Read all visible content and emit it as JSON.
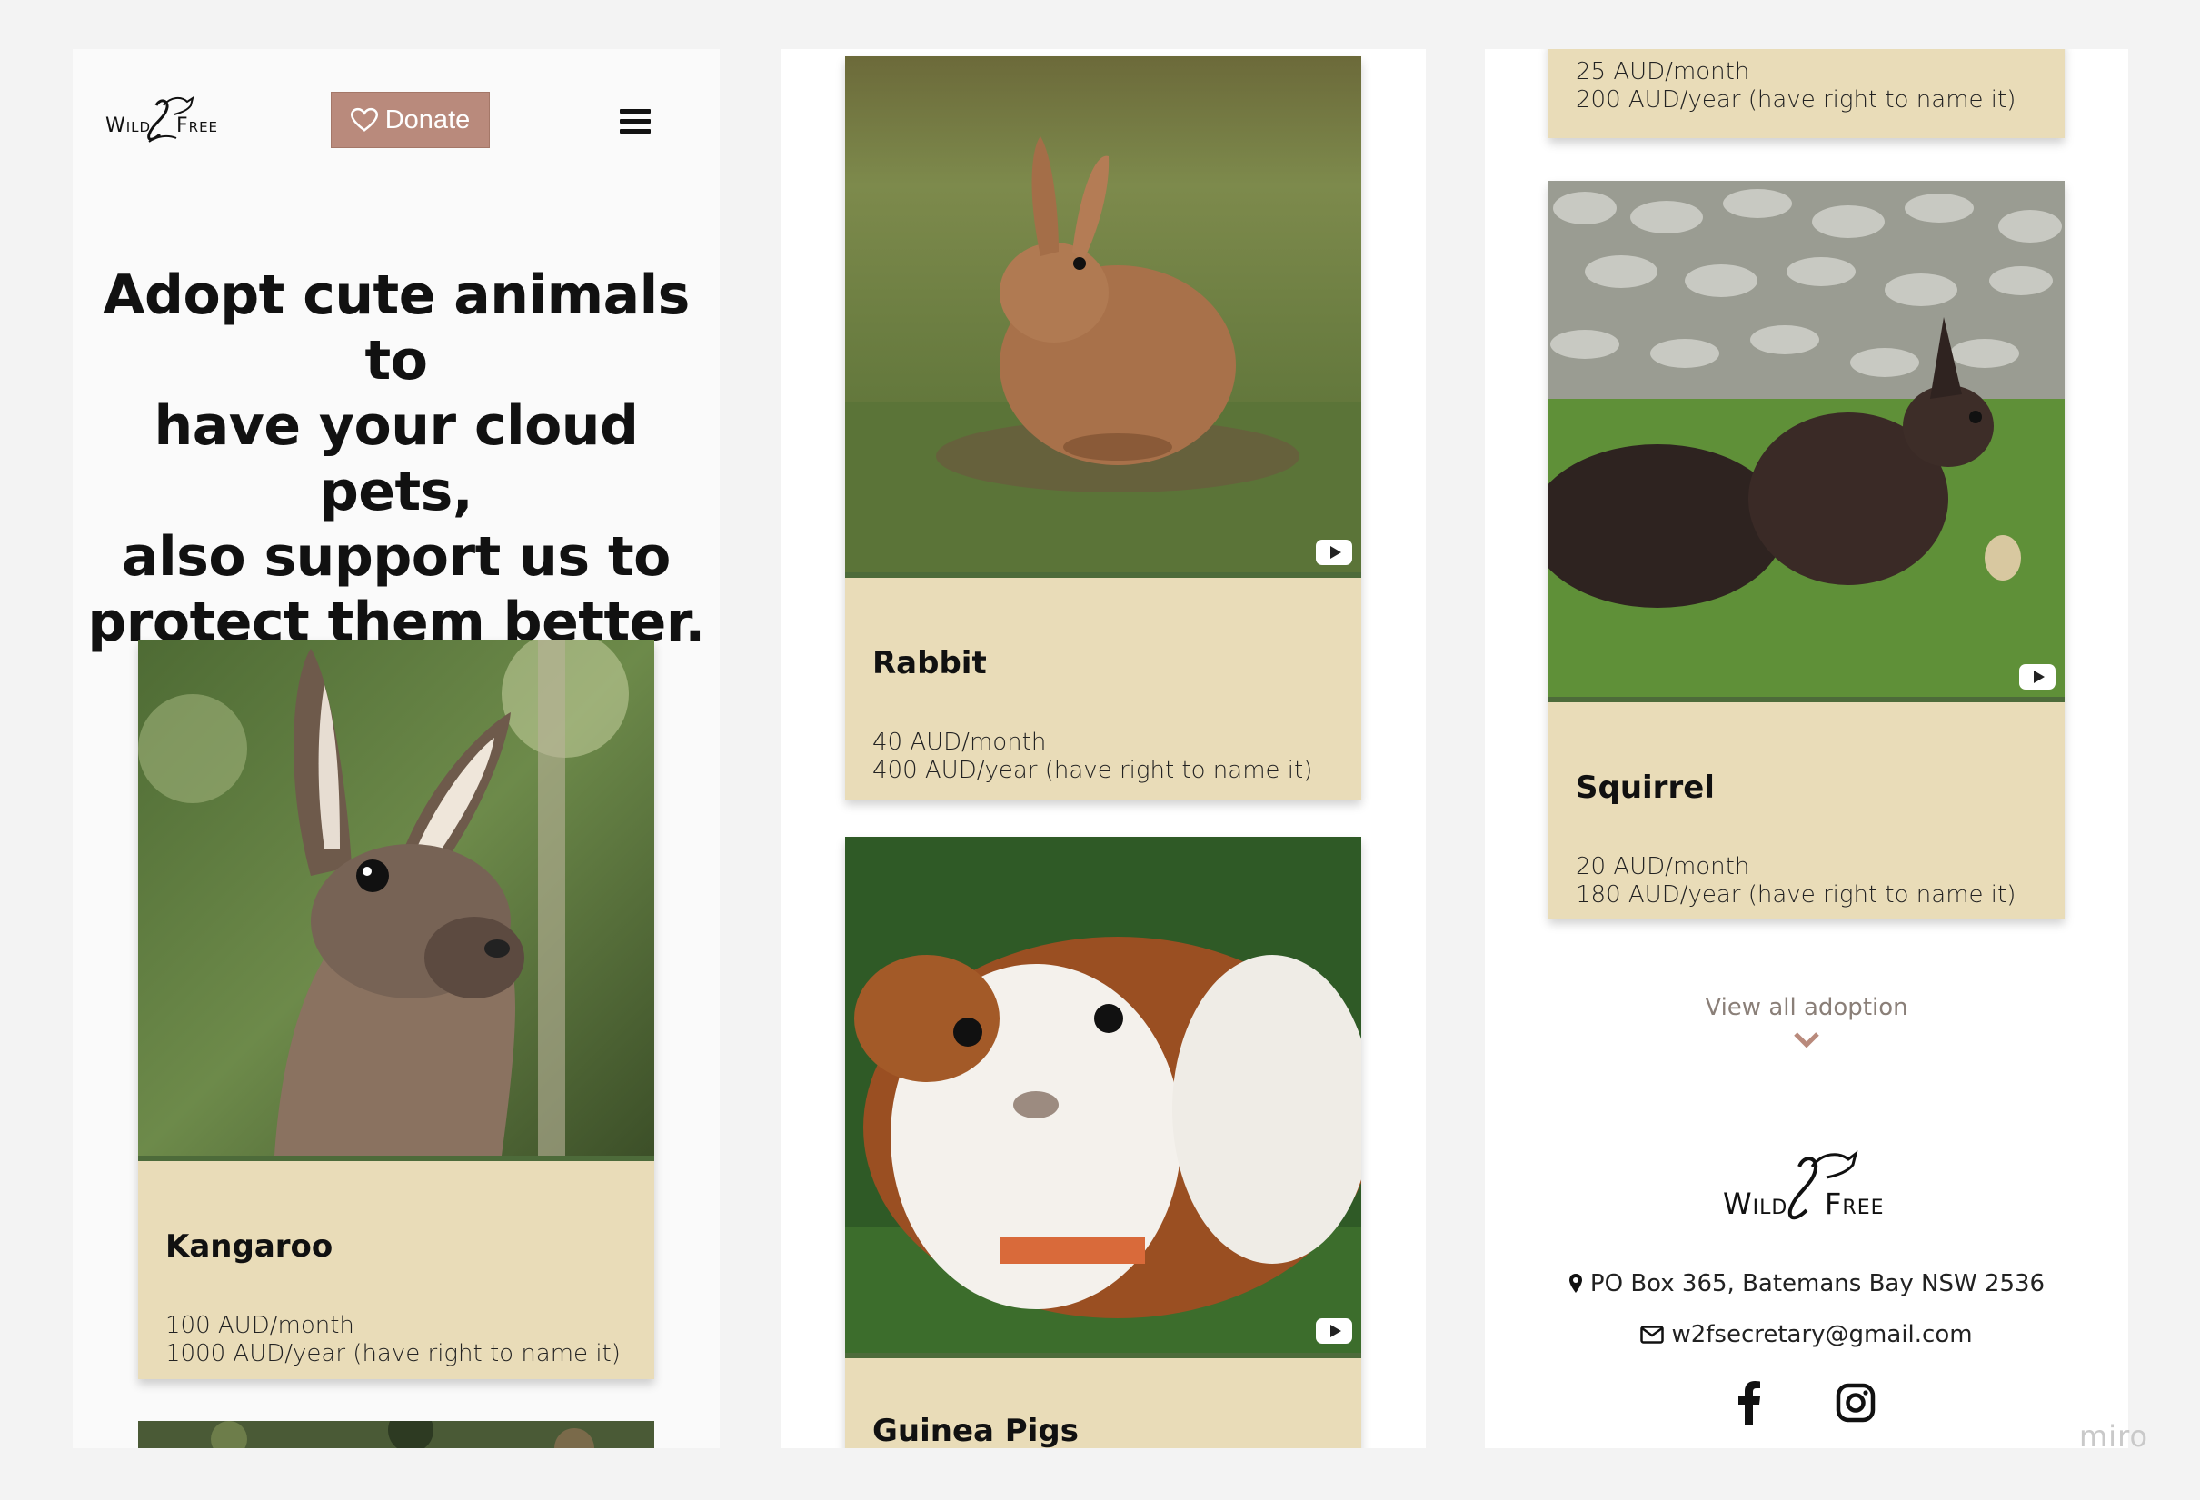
{
  "brand": {
    "logo_left": "Wild",
    "logo_num": "2",
    "logo_right": "Free"
  },
  "header": {
    "donate_label": "Donate"
  },
  "hero": {
    "line1": "Adopt cute animals to",
    "line2": "have your cloud pets,",
    "line3": "also support us to",
    "line4": "protect them better."
  },
  "animals": [
    {
      "name": "Kangaroo",
      "monthly": "100 AUD/month",
      "yearly": "1000 AUD/year (have right to name it)"
    },
    {
      "name": "Rabbit",
      "monthly": "40 AUD/month",
      "yearly": "400 AUD/year (have right to name it)"
    },
    {
      "name": "Guinea Pigs"
    },
    {
      "monthly": "25 AUD/month",
      "yearly": "200 AUD/year (have right to name it)"
    },
    {
      "name": "Squirrel",
      "monthly": "20 AUD/month",
      "yearly": "180 AUD/year (have right to name it)"
    }
  ],
  "view_all": "View all adoption",
  "footer": {
    "address": "PO Box 365, Batemans Bay NSW 2536",
    "email": "w2fsecretary@gmail.com"
  },
  "watermark": "miro",
  "colors": {
    "card": "#e9dcb8",
    "donate": "#b98a7c",
    "photo_border": "#4d6b3a"
  },
  "icons": [
    "heart-icon",
    "hamburger-menu-icon",
    "youtube-icon",
    "chevron-down-icon",
    "map-pin-icon",
    "mail-icon",
    "facebook-icon",
    "instagram-icon"
  ]
}
